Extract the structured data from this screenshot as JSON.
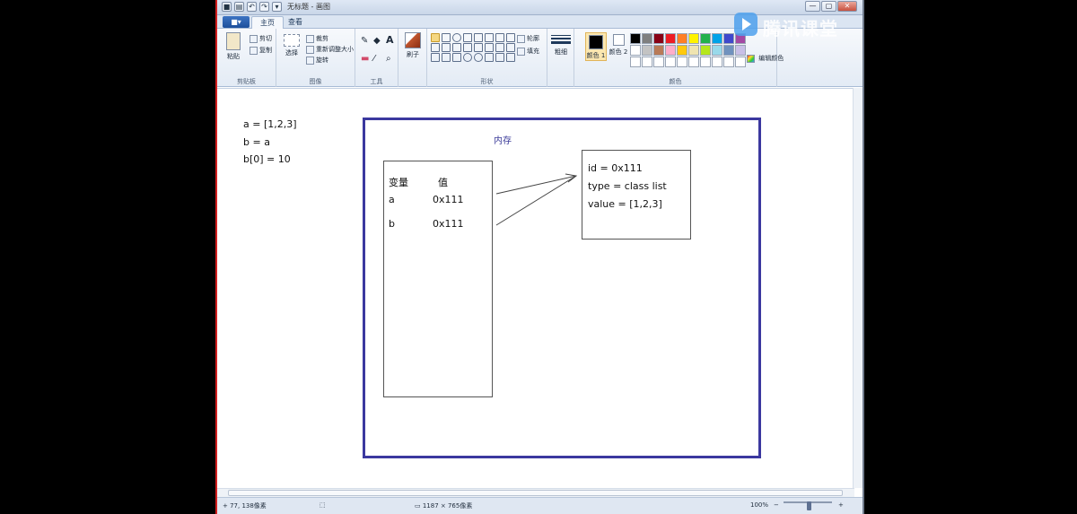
{
  "window": {
    "title": "无标题 - 画图",
    "quick_access_icons": [
      "save-icon",
      "undo-icon",
      "redo-icon",
      "customize-icon"
    ],
    "controls": {
      "minimize": "—",
      "maximize": "▢",
      "close": "✕"
    }
  },
  "ribbon": {
    "app_menu": "■▾",
    "tabs": [
      "主页",
      "查看"
    ],
    "clipboard": {
      "paste": "粘贴",
      "cut": "剪切",
      "copy": "复制",
      "label": "剪贴板"
    },
    "image": {
      "select": "选择",
      "crop": "裁剪",
      "resize": "重新调整大小",
      "rotate": "旋转",
      "label": "图像"
    },
    "tools": {
      "label": "工具",
      "text_icon": "A"
    },
    "brushes": {
      "label": "刷子"
    },
    "shapes": {
      "outline": "轮廓",
      "fill": "填充",
      "label": "形状"
    },
    "size": {
      "label": "粗细"
    },
    "colors": {
      "color1": "颜色 1",
      "color2": "颜色 2",
      "edit": "编辑颜色",
      "label": "颜色",
      "palette": [
        "#000000",
        "#7f7f7f",
        "#880015",
        "#ed1c24",
        "#ff7f27",
        "#fff200",
        "#22b14c",
        "#00a2e8",
        "#3f48cc",
        "#a349a4",
        "#ffffff",
        "#c3c3c3",
        "#b97a57",
        "#ffaec9",
        "#ffc90e",
        "#efe4b0",
        "#b5e61d",
        "#99d9ea",
        "#7092be",
        "#c8bfe7",
        "#ffffff",
        "#ffffff",
        "#ffffff",
        "#ffffff",
        "#ffffff",
        "#ffffff",
        "#ffffff",
        "#ffffff",
        "#ffffff",
        "#ffffff"
      ],
      "color1_value": "#000000",
      "color2_value": "#ffffff"
    }
  },
  "canvas": {
    "code_lines": [
      "a = [1,2,3]",
      "b = a",
      "b[0] = 10"
    ],
    "memory_title": "内存",
    "var_table": {
      "headers": [
        "变量",
        "值"
      ],
      "rows": [
        {
          "name": "a",
          "value": "0x111"
        },
        {
          "name": "b",
          "value": "0x111"
        }
      ]
    },
    "object": {
      "id": "id = 0x111",
      "type": "type = class list",
      "value": "value = [1,2,3]"
    },
    "frame_color": "#3b389f"
  },
  "status": {
    "cursor": "77, 138像素",
    "size": "1187 × 765像素",
    "zoom": "100%",
    "zoom_out": "−",
    "zoom_in": "+"
  },
  "watermark": {
    "text": "腾讯课堂"
  }
}
